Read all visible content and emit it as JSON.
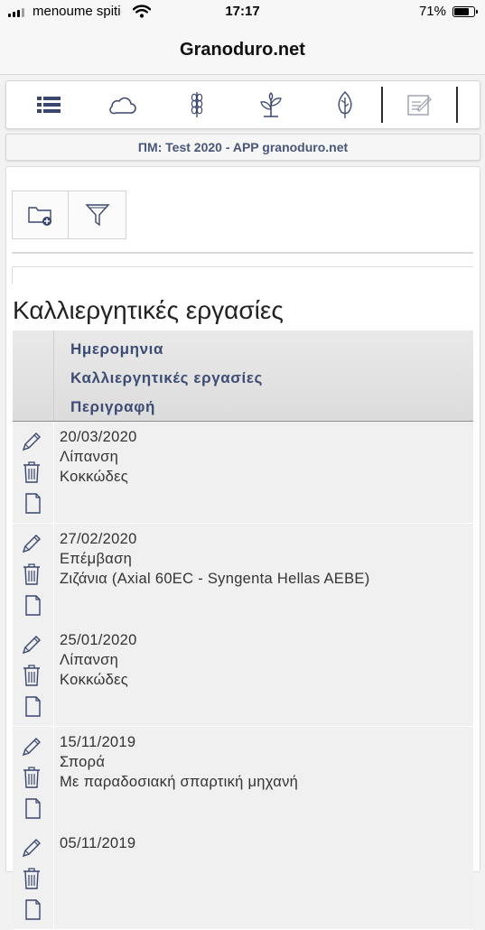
{
  "status": {
    "carrier": "menoume spiti",
    "time": "17:17",
    "battery": "71%"
  },
  "app": {
    "title": "Granoduro.net"
  },
  "toolbar": {
    "items": [
      {
        "icon": "list-icon"
      },
      {
        "icon": "cloud-icon"
      },
      {
        "icon": "wheat-icon"
      },
      {
        "icon": "sprout-icon"
      },
      {
        "icon": "leaf-icon"
      },
      {
        "icon": "notepad-icon"
      }
    ]
  },
  "subtitle": "ΠΜ: Test 2020 - APP granoduro.net",
  "actions": {
    "new_folder_icon": "folder-add-icon",
    "filter_icon": "filter-icon"
  },
  "section": {
    "title": "Καλλιεργητικές εργασίες"
  },
  "table": {
    "headers": [
      "Ημερομηνια",
      "Καλλιεργητικές εργασίες",
      "Περιγραφή"
    ],
    "rows": [
      {
        "date": "20/03/2020",
        "operation": "Λίπανση",
        "description": "Κοκκώδες"
      },
      {
        "date": "27/02/2020",
        "operation": "Επέμβαση",
        "description": "Ζιζάνια (Axial 60EC - Syngenta Hellas AEBE)"
      },
      {
        "date": "25/01/2020",
        "operation": "Λίπανση",
        "description": "Κοκκώδες"
      },
      {
        "date": "15/11/2019",
        "operation": "Σπορά",
        "description": "Με παραδοσιακή σπαρτική μηχανή"
      },
      {
        "date": "05/11/2019",
        "operation": "",
        "description": ""
      }
    ]
  },
  "colors": {
    "header_text": "#3e4c74",
    "icon_stroke": "#3a4670",
    "subtitle_text": "#4a5677"
  }
}
